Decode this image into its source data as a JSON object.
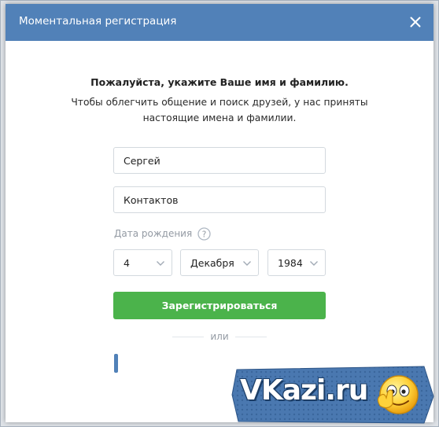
{
  "dialog": {
    "title": "Моментальная регистрация",
    "heading": "Пожалуйста, укажите Ваше имя и фамилию.",
    "subtext": "Чтобы облегчить общение и поиск друзей, у нас приняты настоящие имена и фамилии."
  },
  "form": {
    "first_name": "Сергей",
    "last_name": "Контактов",
    "dob_label": "Дата рождения",
    "day": "4",
    "month": "Декабря",
    "year": "1984",
    "submit_label": "Зарегистрироваться",
    "or_label": "или"
  },
  "watermark": {
    "text": "VKazi.ru"
  },
  "colors": {
    "header": "#5181b8",
    "button": "#4bb34b",
    "muted": "#939aa3"
  },
  "icons": {
    "close": "close-icon",
    "help": "question-icon",
    "chevron": "chevron-down-icon",
    "smiley": "smiley-thumbs-up-icon"
  }
}
